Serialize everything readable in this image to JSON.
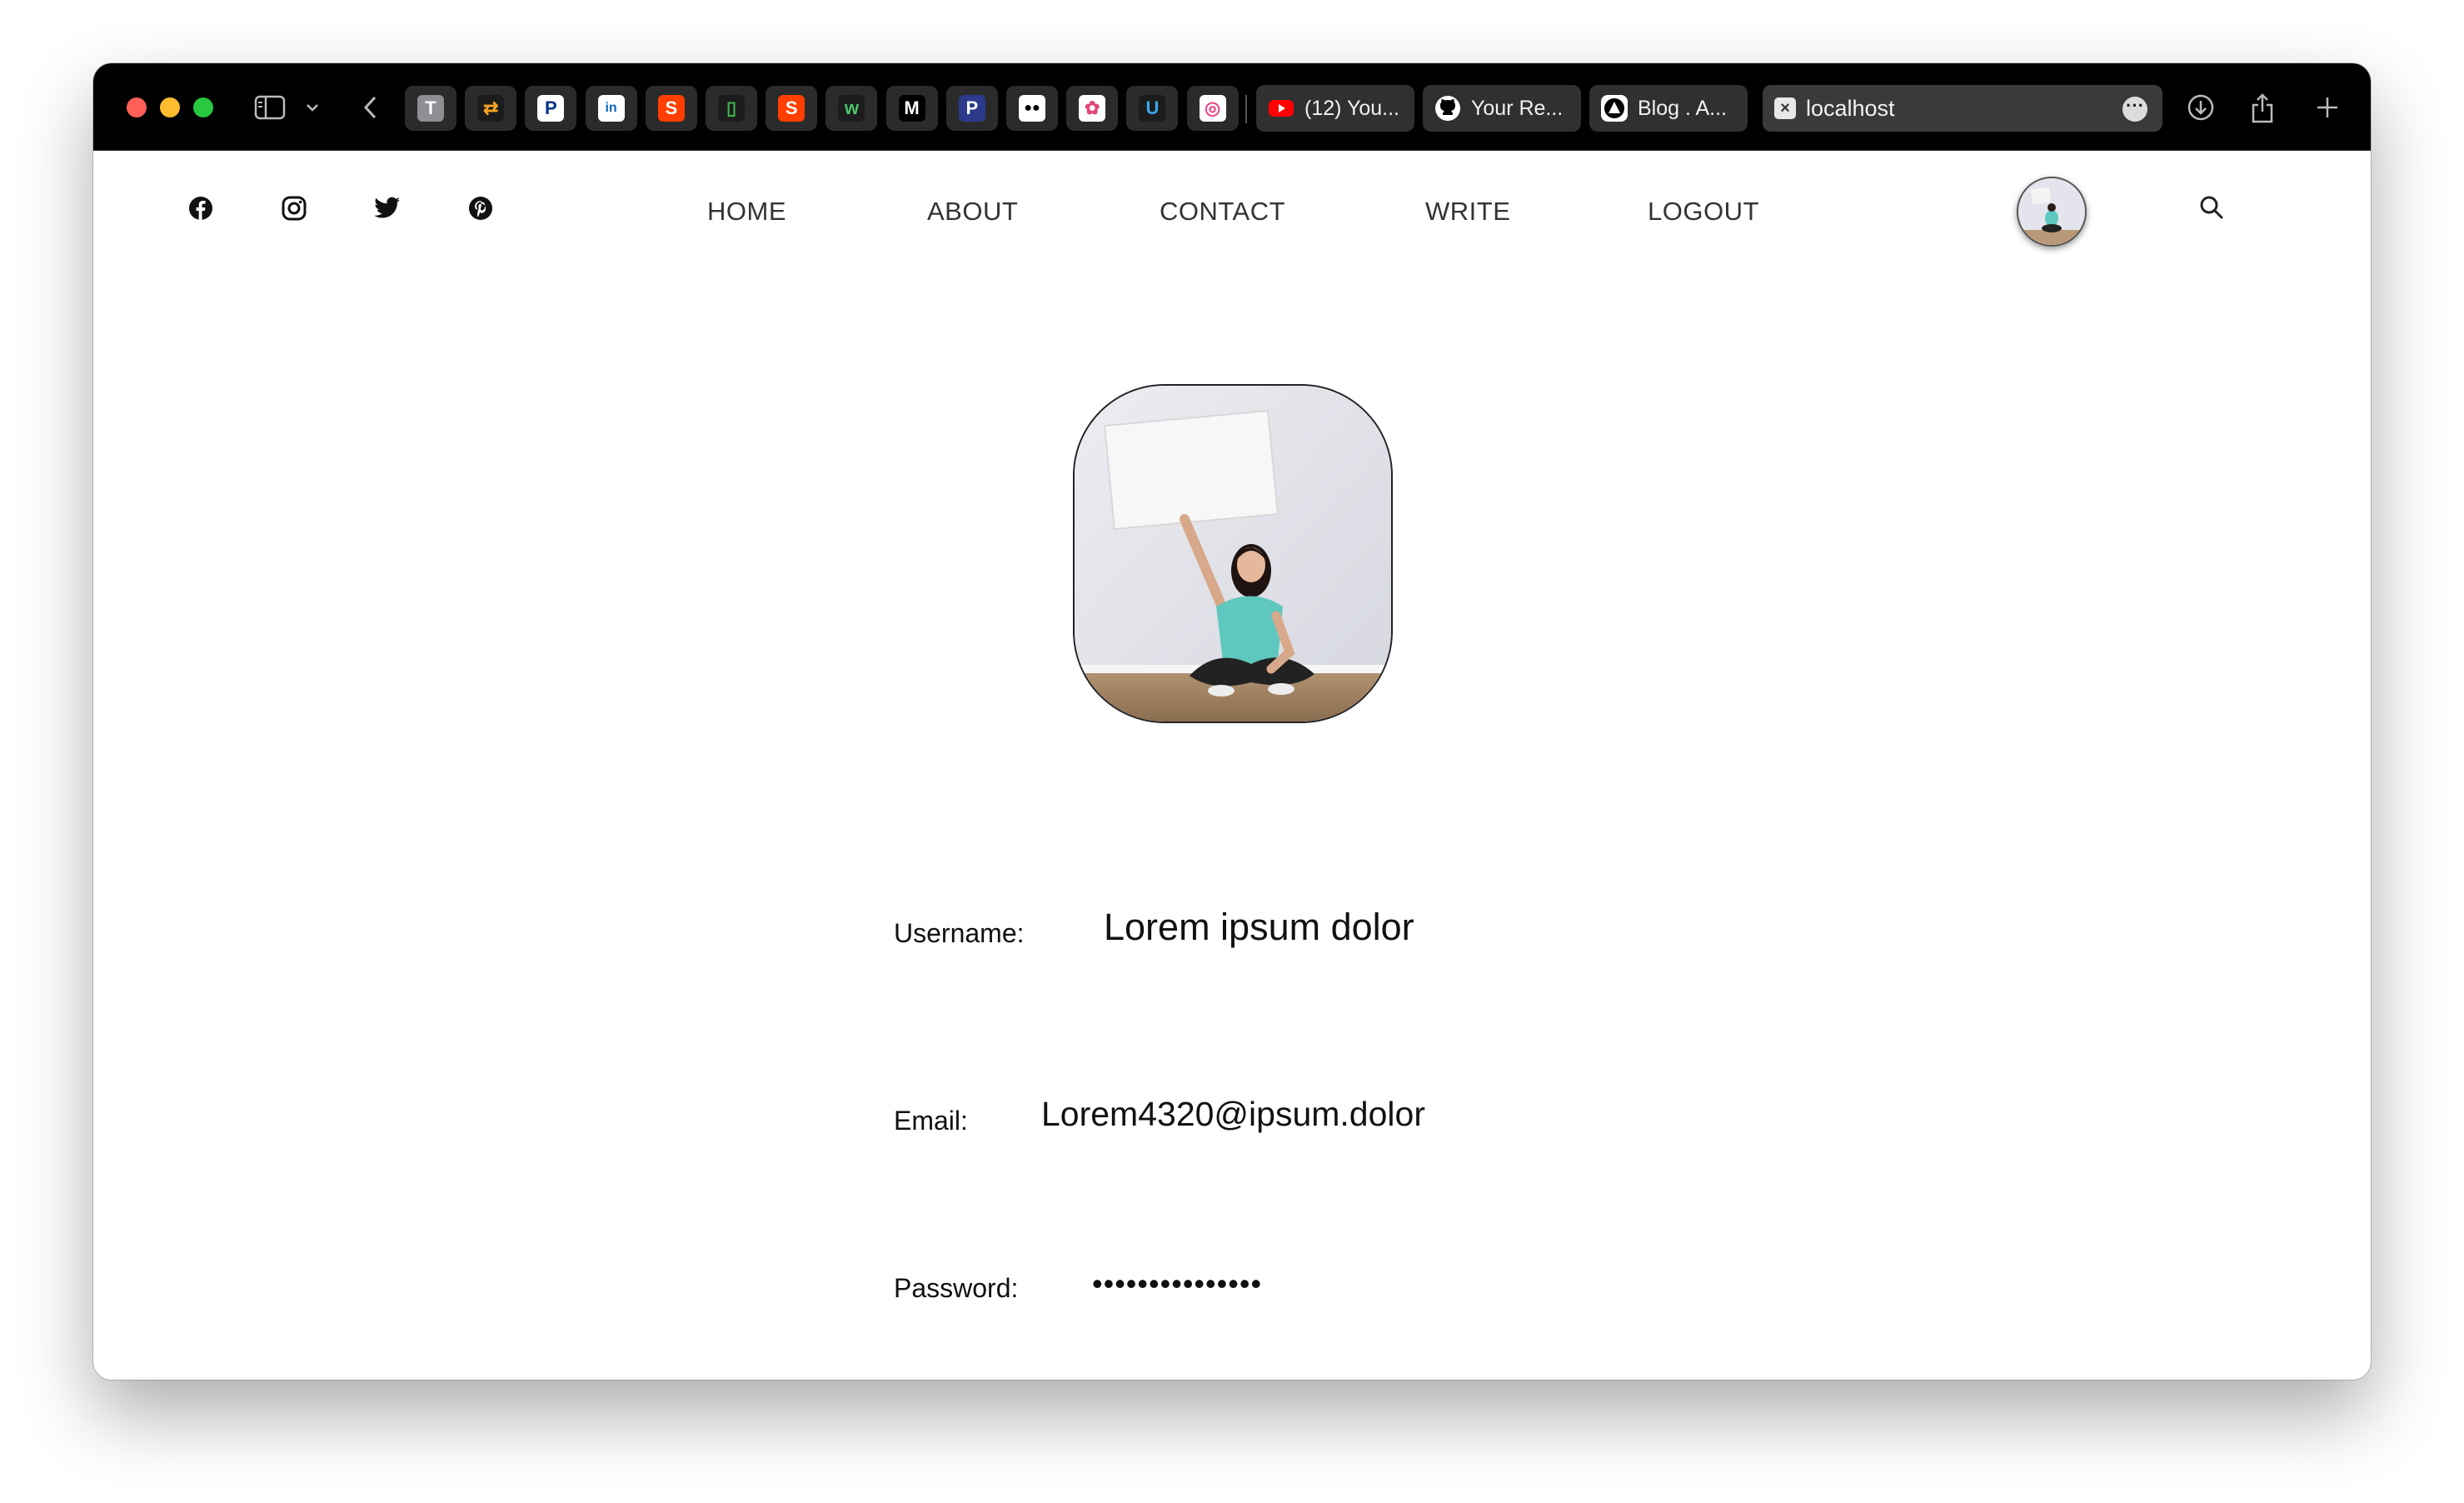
{
  "browser": {
    "pinned_tabs": [
      {
        "name": "t-app",
        "glyph": "T",
        "bg": "#8e8e93",
        "fg": "#ffffff"
      },
      {
        "name": "transfer-app",
        "glyph": "⇄",
        "bg": "#1c1c1c",
        "fg": "#f5a623"
      },
      {
        "name": "paypal",
        "glyph": "P",
        "bg": "#ffffff",
        "fg": "#003087"
      },
      {
        "name": "linkedin",
        "glyph": "in",
        "bg": "#ffffff",
        "fg": "#0a66c2"
      },
      {
        "name": "svelte-1",
        "glyph": "S",
        "bg": "#ff3e00",
        "fg": "#ffffff"
      },
      {
        "name": "green-app",
        "glyph": "▯",
        "bg": "#1c1c1c",
        "fg": "#3fb950"
      },
      {
        "name": "svelte-2",
        "glyph": "S",
        "bg": "#ff3e00",
        "fg": "#ffffff"
      },
      {
        "name": "webflow",
        "glyph": "w",
        "bg": "#1c1c1c",
        "fg": "#4cc46a"
      },
      {
        "name": "medium-m",
        "glyph": "M",
        "bg": "#000000",
        "fg": "#ffffff"
      },
      {
        "name": "p-blue",
        "glyph": "P",
        "bg": "#2d3a8c",
        "fg": "#ffffff"
      },
      {
        "name": "medium-dots",
        "glyph": "●●",
        "bg": "#ffffff",
        "fg": "#000000"
      },
      {
        "name": "colorful-app",
        "glyph": "✿",
        "bg": "#ffffff",
        "fg": "#e0457b"
      },
      {
        "name": "u-app",
        "glyph": "U",
        "bg": "#1c1c1c",
        "fg": "#3ba7f0"
      },
      {
        "name": "dribbble",
        "glyph": "◎",
        "bg": "#ffffff",
        "fg": "#ea4c89"
      }
    ],
    "tabs": [
      {
        "title": "(12) You...",
        "icon": "youtube-icon",
        "color": "#ff0000"
      },
      {
        "title": "Your Re...",
        "icon": "github-icon",
        "color": "#ffffff"
      },
      {
        "title": "Blog . A...",
        "icon": "blog-a-icon",
        "color": "#ffffff"
      }
    ],
    "active_tab": {
      "title": "localhost",
      "icon": "close-square-icon"
    }
  },
  "nav": {
    "home": "HOME",
    "about": "ABOUT",
    "contact": "CONTACT",
    "write": "WRITE",
    "logout": "LOGOUT"
  },
  "social": [
    "facebook-icon",
    "instagram-icon",
    "twitter-icon",
    "pinterest-icon"
  ],
  "profile": {
    "username_label": "Username:",
    "username_value": "Lorem ipsum dolor",
    "email_label": "Email:",
    "email_value": "Lorem4320@ipsum.dolor",
    "password_label": "Password:",
    "password_value": "•••••••••••••••"
  }
}
